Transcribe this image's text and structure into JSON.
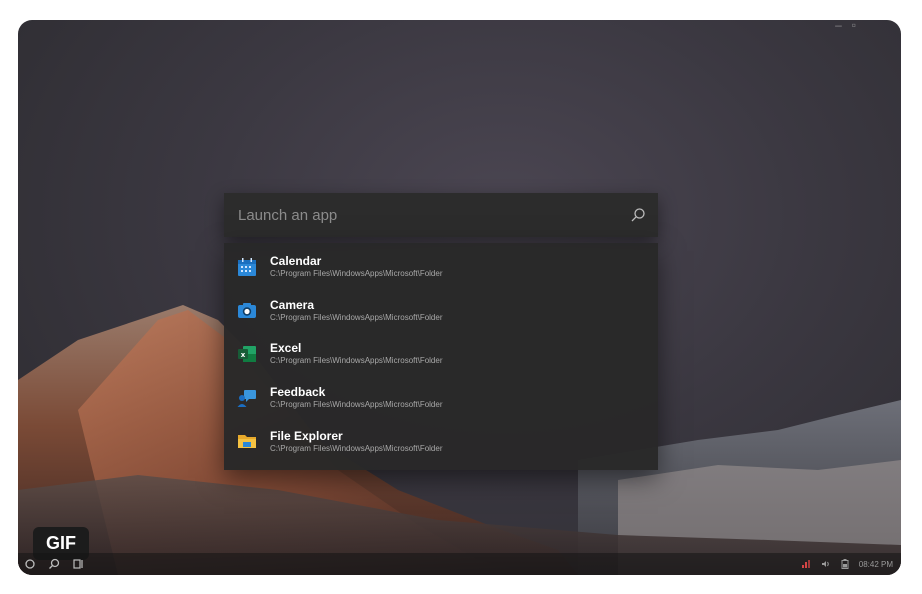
{
  "launcher": {
    "placeholder": "Launch an app"
  },
  "results": [
    {
      "name": "Calendar",
      "path": "C:\\Program Files\\WindowsApps\\Microsoft\\Folder",
      "icon": "calendar-icon"
    },
    {
      "name": "Camera",
      "path": "C:\\Program Files\\WindowsApps\\Microsoft\\Folder",
      "icon": "camera-icon"
    },
    {
      "name": "Excel",
      "path": "C:\\Program Files\\WindowsApps\\Microsoft\\Folder",
      "icon": "excel-icon"
    },
    {
      "name": "Feedback",
      "path": "C:\\Program Files\\WindowsApps\\Microsoft\\Folder",
      "icon": "feedback-icon"
    },
    {
      "name": "File Explorer",
      "path": "C:\\Program Files\\WindowsApps\\Microsoft\\Folder",
      "icon": "file-explorer-icon"
    }
  ],
  "badge": {
    "label": "GIF"
  },
  "taskbar": {
    "time": "08:42 PM",
    "left_icons": [
      "start-icon",
      "search-icon",
      "task-view-icon"
    ],
    "tray_icons": [
      "network-icon",
      "volume-icon",
      "battery-icon"
    ]
  },
  "colors": {
    "accent_blue": "#2b88d8",
    "excel_green": "#1d6f42",
    "folder_yellow": "#f5c242"
  }
}
